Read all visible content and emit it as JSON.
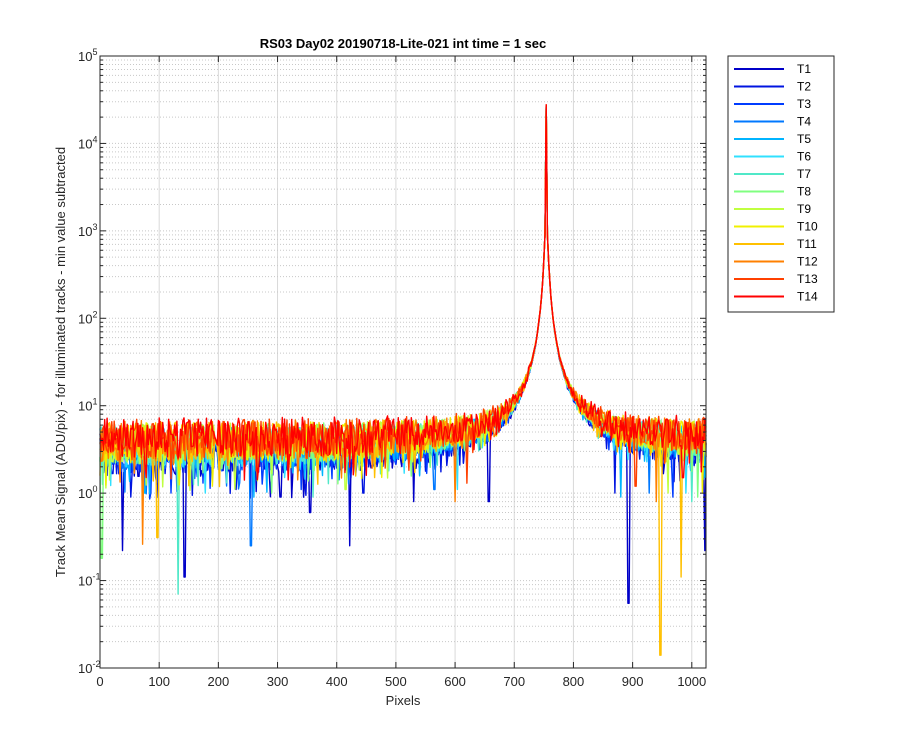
{
  "chart_data": {
    "type": "line",
    "title": "RS03 Day02 20190718-Lite-021 int time = 1 sec",
    "xlabel": "Pixels",
    "ylabel": "Track Mean Signal (ADU/pix) - for illuminated tracks - min value subtracted",
    "xlim": [
      0,
      1024
    ],
    "ylim": [
      0.01,
      100000
    ],
    "yscale": "log",
    "grid": true,
    "legend_position": "outside-top-right",
    "x_ticks": [
      0,
      100,
      200,
      300,
      400,
      500,
      600,
      700,
      800,
      900,
      1000
    ],
    "y_ticks": [
      {
        "value": 0.01,
        "base": "10",
        "exp": "-2"
      },
      {
        "value": 0.1,
        "base": "10",
        "exp": "-1"
      },
      {
        "value": 1,
        "base": "10",
        "exp": "0"
      },
      {
        "value": 10,
        "base": "10",
        "exp": "1"
      },
      {
        "value": 100,
        "base": "10",
        "exp": "2"
      },
      {
        "value": 1000,
        "base": "10",
        "exp": "3"
      },
      {
        "value": 10000,
        "base": "10",
        "exp": "4"
      },
      {
        "value": 100000,
        "base": "10",
        "exp": "5"
      }
    ],
    "peak": {
      "x": 754,
      "y": 28000
    },
    "baseline_level": 3.5,
    "series": [
      {
        "name": "T1",
        "color": "#0000c8",
        "offset": 0.7,
        "dips": [
          [
            38,
            0.22
          ],
          [
            143,
            0.11
          ],
          [
            305,
            0.9
          ],
          [
            355,
            0.6
          ],
          [
            422,
            0.25
          ],
          [
            530,
            0.8
          ],
          [
            657,
            0.8
          ],
          [
            893,
            0.055
          ],
          [
            1022,
            0.22
          ]
        ]
      },
      {
        "name": "T2",
        "color": "#0014e0",
        "offset": 0.75,
        "dips": [
          [
            52,
            0.9
          ],
          [
            230,
            1.1
          ],
          [
            445,
            1.0
          ],
          [
            870,
            1.0
          ]
        ]
      },
      {
        "name": "T3",
        "color": "#003cff",
        "offset": 0.8,
        "dips": [
          [
            120,
            1.0
          ],
          [
            340,
            1.1
          ],
          [
            968,
            0.9
          ]
        ]
      },
      {
        "name": "T4",
        "color": "#0078ff",
        "offset": 0.85,
        "dips": [
          [
            255,
            0.25
          ],
          [
            565,
            1.1
          ],
          [
            928,
            1.0
          ]
        ]
      },
      {
        "name": "T5",
        "color": "#00b4ff",
        "offset": 0.9,
        "dips": [
          [
            75,
            1.0
          ],
          [
            260,
            0.9
          ],
          [
            880,
            0.9
          ]
        ]
      },
      {
        "name": "T6",
        "color": "#30e0ff",
        "offset": 0.92,
        "dips": [
          [
            178,
            1.0
          ],
          [
            604,
            1.1
          ],
          [
            990,
            1.0
          ]
        ]
      },
      {
        "name": "T7",
        "color": "#50e8c8",
        "offset": 0.95,
        "dips": [
          [
            132,
            0.07
          ],
          [
            360,
            0.9
          ],
          [
            1000,
            0.8
          ]
        ]
      },
      {
        "name": "T8",
        "color": "#80ff80",
        "offset": 1.0,
        "dips": [
          [
            3,
            0.18
          ],
          [
            290,
            1.0
          ],
          [
            1010,
            0.9
          ]
        ]
      },
      {
        "name": "T9",
        "color": "#c0ff40",
        "offset": 1.02,
        "dips": [
          [
            415,
            1.1
          ],
          [
            960,
            1.0
          ]
        ]
      },
      {
        "name": "T10",
        "color": "#f0f000",
        "offset": 1.04,
        "dips": [
          [
            1018,
            1.0
          ],
          [
            190,
            1.2
          ]
        ]
      },
      {
        "name": "T11",
        "color": "#ffc000",
        "offset": 1.06,
        "dips": [
          [
            97,
            0.31
          ],
          [
            947,
            0.014
          ],
          [
            982,
            0.11
          ]
        ]
      },
      {
        "name": "T12",
        "color": "#ff8000",
        "offset": 1.1,
        "dips": [
          [
            72,
            0.26
          ],
          [
            600,
            0.8
          ],
          [
            940,
            0.8
          ]
        ]
      },
      {
        "name": "T13",
        "color": "#ff4000",
        "offset": 1.14,
        "dips": [
          [
            620,
            1.3
          ],
          [
            905,
            1.2
          ]
        ]
      },
      {
        "name": "T14",
        "color": "#ff0000",
        "offset": 1.18,
        "dips": [
          [
            450,
            1.6
          ],
          [
            985,
            1.5
          ]
        ]
      }
    ]
  }
}
